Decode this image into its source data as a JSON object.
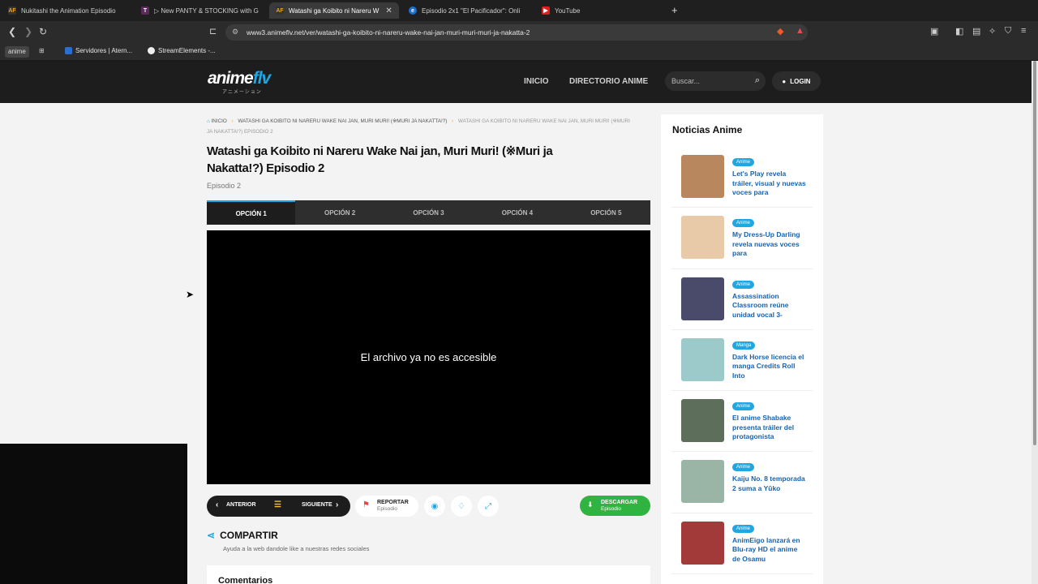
{
  "browser": {
    "tabs": [
      {
        "title": "Nukitashi the Animation Episodio",
        "active": false
      },
      {
        "title": "▷ New PANTY & STOCKING with G",
        "active": false
      },
      {
        "title": "Watashi ga Koibito ni Nareru W",
        "active": true
      },
      {
        "title": "Episodio 2x1 \"El Pacificador\": Onli",
        "active": false
      },
      {
        "title": "YouTube",
        "active": false
      }
    ],
    "url": "www3.animeflv.net/ver/watashi-ga-koibito-ni-nareru-wake-nai-jan-muri-muri-muri-ja-nakatta-2",
    "bookmarks": {
      "profile_chip": "anime",
      "item1": "Servidores | Atern...",
      "item2": "StreamElements -..."
    }
  },
  "header": {
    "logo_main": "anime",
    "logo_accent": "flv",
    "logo_sub": "アニメーション",
    "nav": {
      "inicio": "INICIO",
      "directorio": "DIRECTORIO ANIME"
    },
    "search_placeholder": "Buscar...",
    "login": "LOGIN"
  },
  "breadcrumb": {
    "home": "INICIO",
    "series": "WATASHI GA KOIBITO NI NARERU WAKE NAI JAN, MURI MURI! (※MURI JA NAKATTA!?)",
    "current": "WATASHI GA KOIBITO NI NARERU WAKE NAI JAN, MURI MURI! (※MURI JA NAKATTA!?) EPISODIO 2"
  },
  "episode": {
    "title": "Watashi ga Koibito ni Nareru Wake Nai jan, Muri Muri! (※Muri ja Nakatta!?) Episodio 2",
    "subtitle": "Episodio 2"
  },
  "options": [
    "OPCIÓN 1",
    "OPCIÓN 2",
    "OPCIÓN 3",
    "OPCIÓN 4",
    "OPCIÓN 5"
  ],
  "player": {
    "message": "El archivo ya no es accesible"
  },
  "controls": {
    "prev": "ANTERIOR",
    "next": "SIGUIENTE",
    "report_title": "REPORTAR",
    "report_sub": "Episodio",
    "download_title": "DESCARGAR",
    "download_sub": "Episodio"
  },
  "share": {
    "title": "COMPARTIR",
    "subtitle": "Ayuda a la web dandole like a nuestras redes sociales"
  },
  "comments": {
    "title": "Comentarios"
  },
  "sidebar": {
    "title": "Noticias Anime",
    "news": [
      {
        "tag": "Anime",
        "title": "Let's Play revela tráiler, visual y nuevas voces para",
        "thumb_color": "#b8875d"
      },
      {
        "tag": "Anime",
        "title": "My Dress-Up Darling revela nuevas voces para",
        "thumb_color": "#e8c9a8"
      },
      {
        "tag": "Anime",
        "title": "Assassination Classroom reúne unidad vocal 3-",
        "thumb_color": "#4a4a6a"
      },
      {
        "tag": "Manga",
        "title": "Dark Horse licencia el manga Credits Roll Into",
        "thumb_color": "#9cc9c9"
      },
      {
        "tag": "Anime",
        "title": "El anime Shabake presenta tráiler del protagonista",
        "thumb_color": "#5d6e5a"
      },
      {
        "tag": "Anime",
        "title": "Kaiju No. 8 temporada 2 suma a Yūko",
        "thumb_color": "#9ab5a6"
      },
      {
        "tag": "Anime",
        "title": "AnimEigo lanzará en Blu-ray HD el anime de Osamu",
        "thumb_color": "#a33a3a"
      }
    ]
  }
}
